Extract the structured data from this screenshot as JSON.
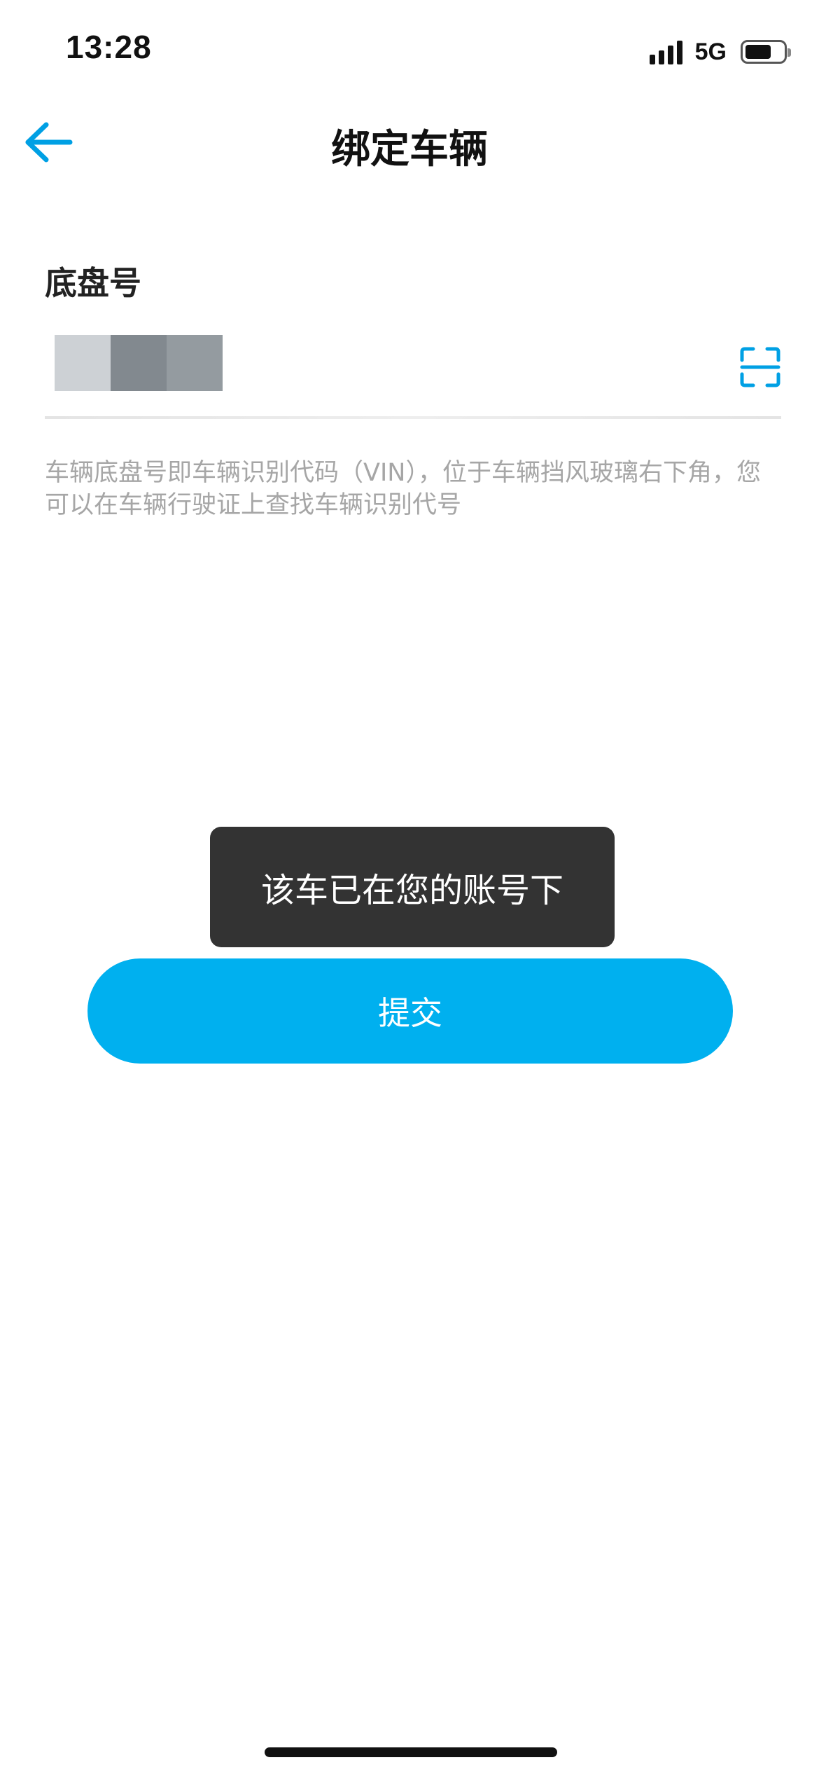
{
  "status_bar": {
    "time": "13:28",
    "network": "5G",
    "battery_level": 0.7
  },
  "nav": {
    "title": "绑定车辆",
    "back_icon": "arrow-left-icon"
  },
  "form": {
    "field_label": "底盘号",
    "scan_icon": "scan-icon",
    "hint": "车辆底盘号即车辆识别代码（VIN），位于车辆挡风玻璃右下角，您可以在车辆行驶证上查找车辆识别代号"
  },
  "toast": {
    "message": "该车已在您的账号下"
  },
  "submit": {
    "label": "提交"
  },
  "colors": {
    "accent": "#00b0ef",
    "toast_bg": "#333333",
    "hint_text": "#a6a6a6"
  }
}
